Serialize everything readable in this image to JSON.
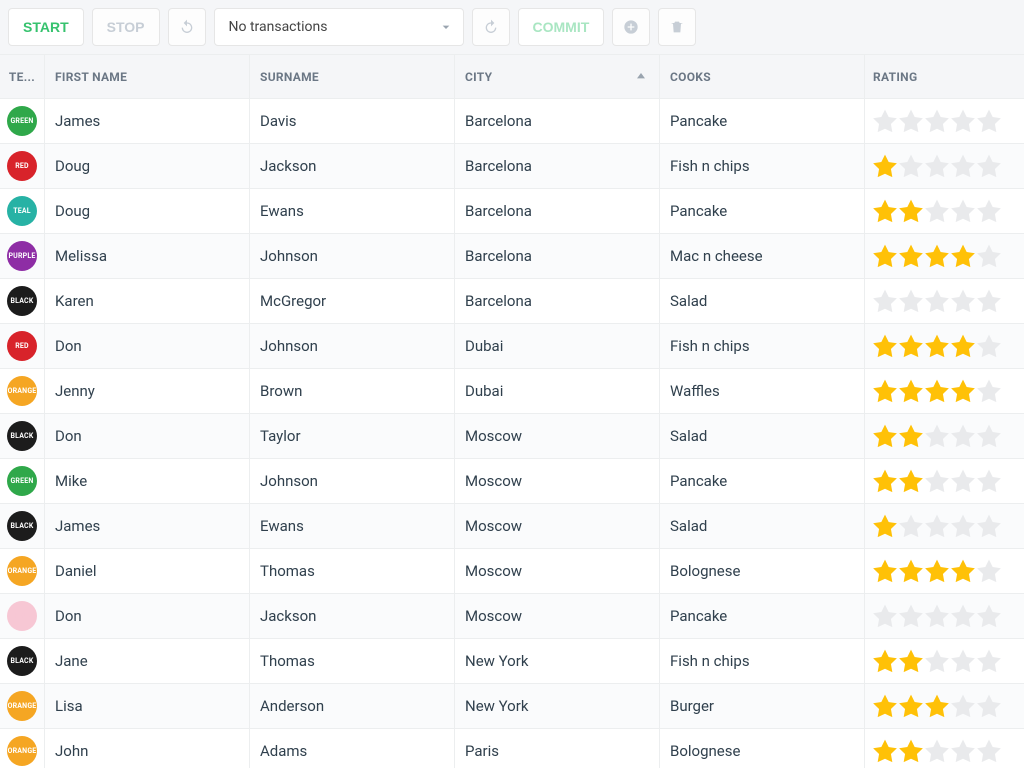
{
  "toolbar": {
    "start": "START",
    "stop": "STOP",
    "commit": "COMMIT",
    "transactions_selected": "No transactions"
  },
  "columns": {
    "team": "TE...",
    "first_name": "FIRST NAME",
    "surname": "SURNAME",
    "city": "CITY",
    "cooks": "COOKS",
    "rating": "RATING"
  },
  "sort": {
    "column": "city",
    "dir": "asc"
  },
  "team_colors": {
    "GREEN": "b-green",
    "RED": "b-red",
    "TEAL": "b-teal",
    "PURPLE": "b-purple",
    "BLACK": "b-black",
    "ORANGE": "b-orange",
    "PINK": "b-pink"
  },
  "rows": [
    {
      "team": "GREEN",
      "first": "James",
      "surname": "Davis",
      "city": "Barcelona",
      "cooks": "Pancake",
      "rating": 0
    },
    {
      "team": "RED",
      "first": "Doug",
      "surname": "Jackson",
      "city": "Barcelona",
      "cooks": "Fish n chips",
      "rating": 1
    },
    {
      "team": "TEAL",
      "first": "Doug",
      "surname": "Ewans",
      "city": "Barcelona",
      "cooks": "Pancake",
      "rating": 2
    },
    {
      "team": "PURPLE",
      "first": "Melissa",
      "surname": "Johnson",
      "city": "Barcelona",
      "cooks": "Mac n cheese",
      "rating": 4
    },
    {
      "team": "BLACK",
      "first": "Karen",
      "surname": "McGregor",
      "city": "Barcelona",
      "cooks": "Salad",
      "rating": 0
    },
    {
      "team": "RED",
      "first": "Don",
      "surname": "Johnson",
      "city": "Dubai",
      "cooks": "Fish n chips",
      "rating": 4
    },
    {
      "team": "ORANGE",
      "first": "Jenny",
      "surname": "Brown",
      "city": "Dubai",
      "cooks": "Waffles",
      "rating": 4
    },
    {
      "team": "BLACK",
      "first": "Don",
      "surname": "Taylor",
      "city": "Moscow",
      "cooks": "Salad",
      "rating": 2
    },
    {
      "team": "GREEN",
      "first": "Mike",
      "surname": "Johnson",
      "city": "Moscow",
      "cooks": "Pancake",
      "rating": 2
    },
    {
      "team": "BLACK",
      "first": "James",
      "surname": "Ewans",
      "city": "Moscow",
      "cooks": "Salad",
      "rating": 1
    },
    {
      "team": "ORANGE",
      "first": "Daniel",
      "surname": "Thomas",
      "city": "Moscow",
      "cooks": "Bolognese",
      "rating": 4
    },
    {
      "team": "PINK",
      "first": "Don",
      "surname": "Jackson",
      "city": "Moscow",
      "cooks": "Pancake",
      "rating": 0
    },
    {
      "team": "BLACK",
      "first": "Jane",
      "surname": "Thomas",
      "city": "New York",
      "cooks": "Fish n chips",
      "rating": 2
    },
    {
      "team": "ORANGE",
      "first": "Lisa",
      "surname": "Anderson",
      "city": "New York",
      "cooks": "Burger",
      "rating": 3
    },
    {
      "team": "ORANGE",
      "first": "John",
      "surname": "Adams",
      "city": "Paris",
      "cooks": "Bolognese",
      "rating": 2
    }
  ]
}
